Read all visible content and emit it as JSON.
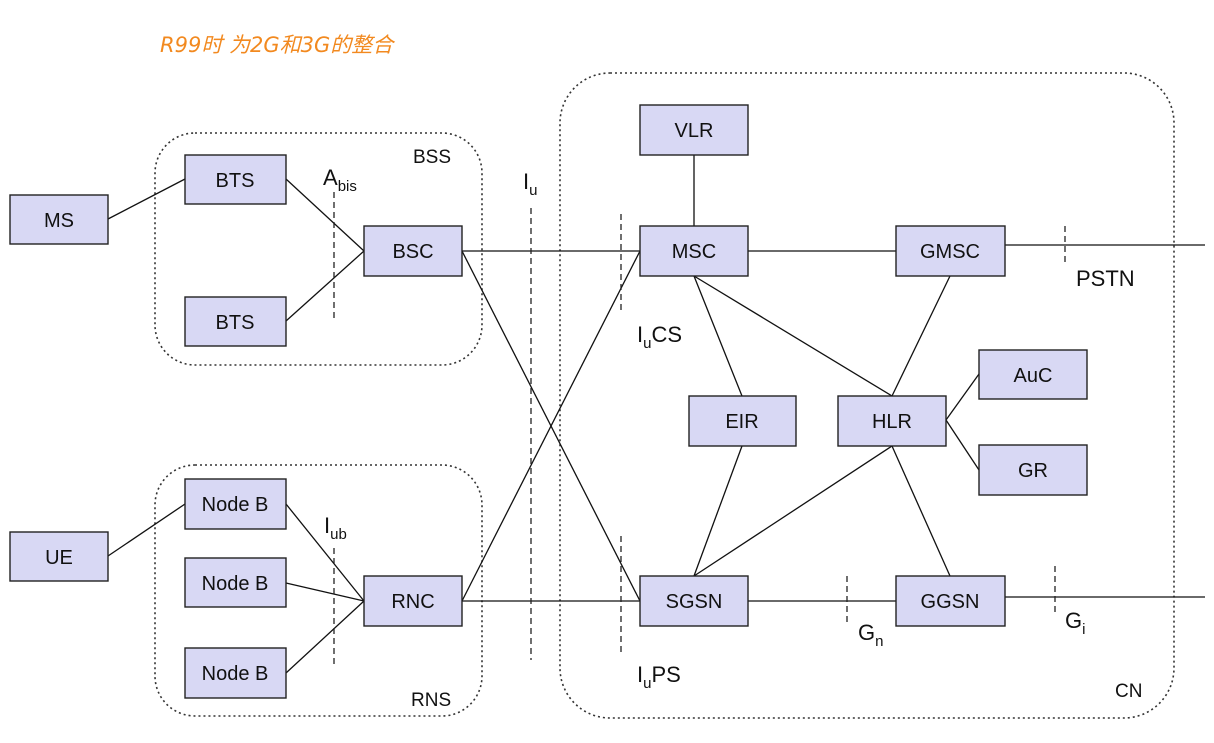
{
  "annotation": "R99时 为2G和3G的整合",
  "regions": {
    "bss": "BSS",
    "rns": "RNS",
    "cn": "CN"
  },
  "nodes": {
    "ms": "MS",
    "ue": "UE",
    "bts1": "BTS",
    "bts2": "BTS",
    "bsc": "BSC",
    "nodeb1": "Node B",
    "nodeb2": "Node B",
    "nodeb3": "Node B",
    "rnc": "RNC",
    "vlr": "VLR",
    "msc": "MSC",
    "gmsc": "GMSC",
    "eir": "EIR",
    "hlr": "HLR",
    "auc": "AuC",
    "gr": "GR",
    "sgsn": "SGSN",
    "ggsn": "GGSN"
  },
  "interfaces": {
    "abis": {
      "base": "A",
      "sub": "bis"
    },
    "iu": {
      "base": "I",
      "sub": "u"
    },
    "iub": {
      "base": "I",
      "sub": "ub"
    },
    "iucs": {
      "base": "I",
      "sub": "u",
      "tail": "CS"
    },
    "iups": {
      "base": "I",
      "sub": "u",
      "tail": "PS"
    },
    "gn": {
      "base": "G",
      "sub": "n"
    },
    "gi": {
      "base": "G",
      "sub": "i"
    },
    "pstn": "PSTN"
  }
}
